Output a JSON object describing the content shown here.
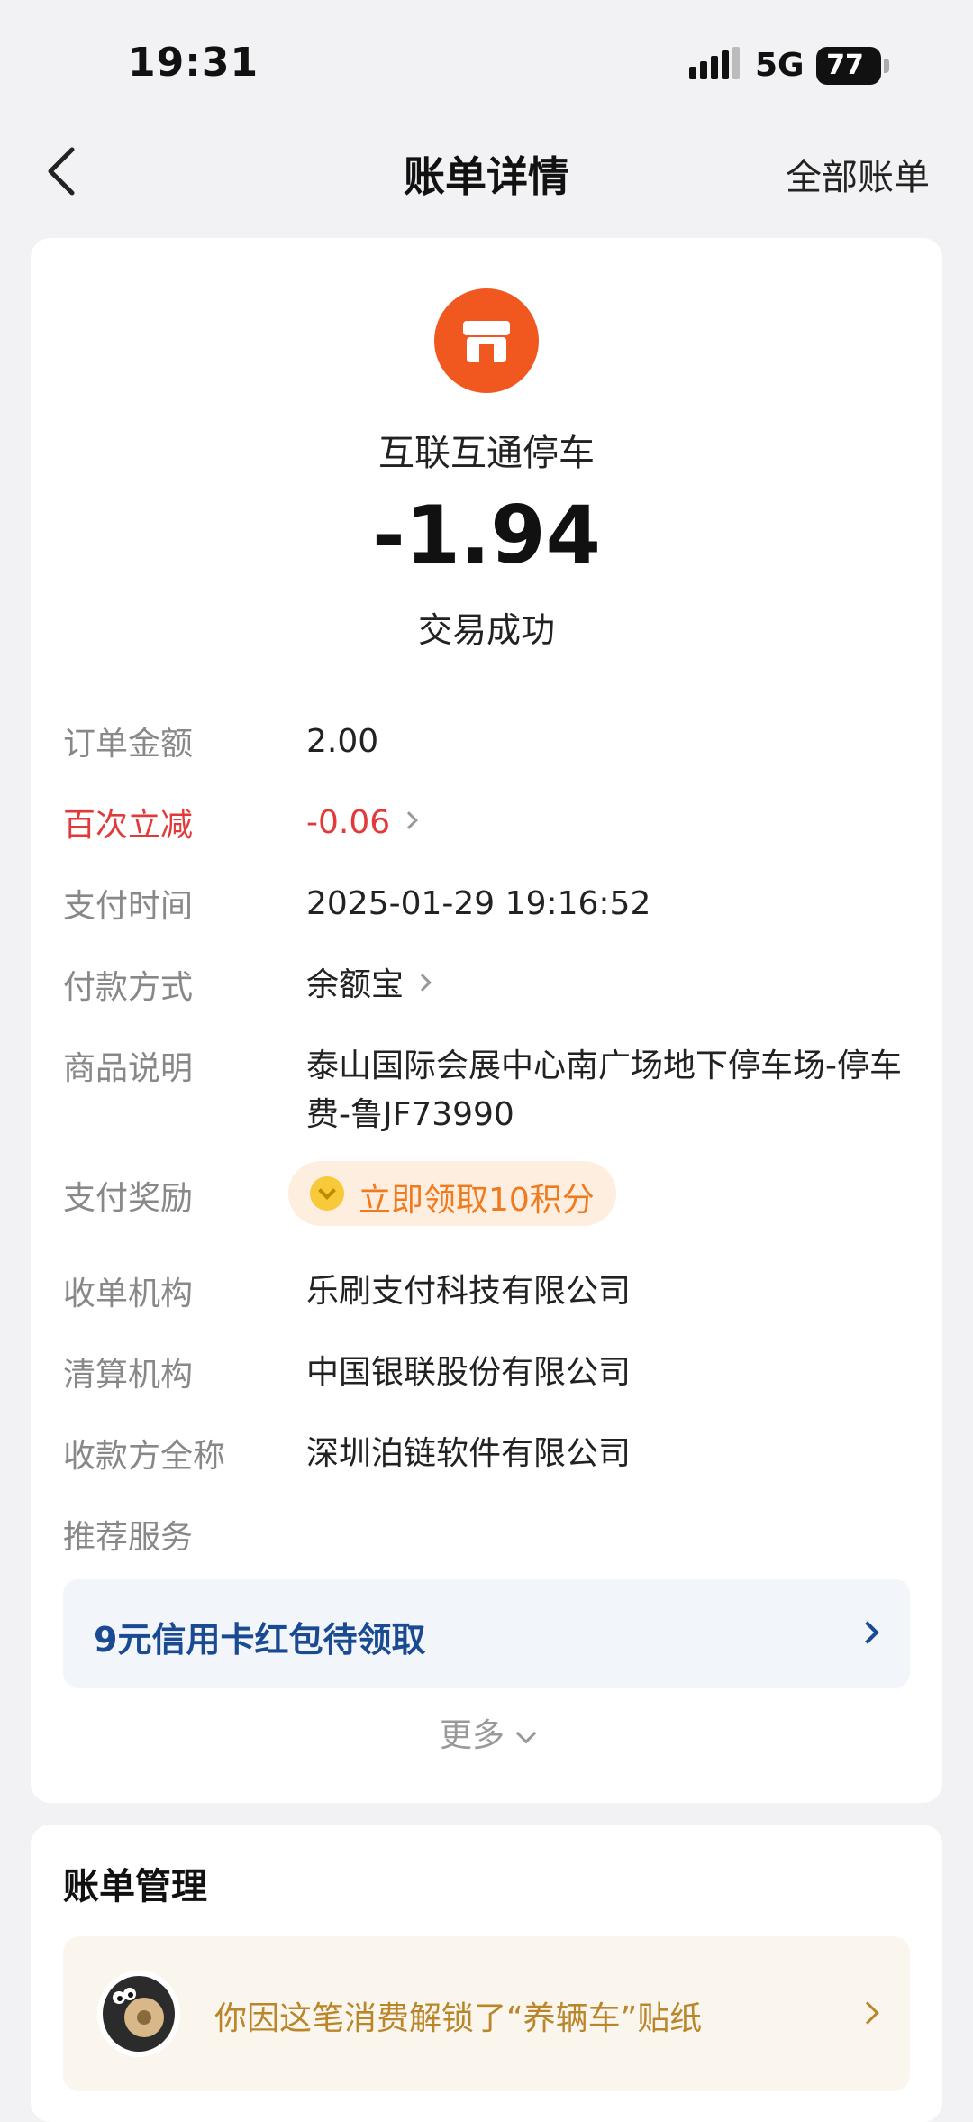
{
  "status_bar": {
    "time": "19:31",
    "network": "5G",
    "battery": "77"
  },
  "nav": {
    "title": "账单详情",
    "all_bills": "全部账单"
  },
  "merchant": {
    "name": "互联互通停车",
    "icon": "store-icon",
    "icon_color": "#f0581f"
  },
  "transaction": {
    "amount": "-1.94",
    "status": "交易成功"
  },
  "details": {
    "order_amount": {
      "label": "订单金额",
      "value": "2.00"
    },
    "discount": {
      "label": "百次立减",
      "value": "-0.06",
      "color": "#e23a3a"
    },
    "pay_time": {
      "label": "支付时间",
      "value": "2025-01-29 19:16:52"
    },
    "pay_method": {
      "label": "付款方式",
      "value": "余额宝"
    },
    "description": {
      "label": "商品说明",
      "value": "泰山国际会展中心南广场地下停车场-停车费-鲁JF73990"
    },
    "reward": {
      "label": "支付奖励",
      "value": "立即领取10积分"
    },
    "acquirer": {
      "label": "收单机构",
      "value": "乐刷支付科技有限公司"
    },
    "clearing": {
      "label": "清算机构",
      "value": "中国银联股份有限公司"
    },
    "payee": {
      "label": "收款方全称",
      "value": "深圳泊链软件有限公司"
    },
    "recommend": {
      "label": "推荐服务"
    }
  },
  "promo": {
    "text": "9元信用卡红包待领取"
  },
  "more": {
    "label": "更多"
  },
  "manage": {
    "title": "账单管理",
    "sticker_text": "你因这笔消费解锁了“养辆车”贴纸"
  }
}
